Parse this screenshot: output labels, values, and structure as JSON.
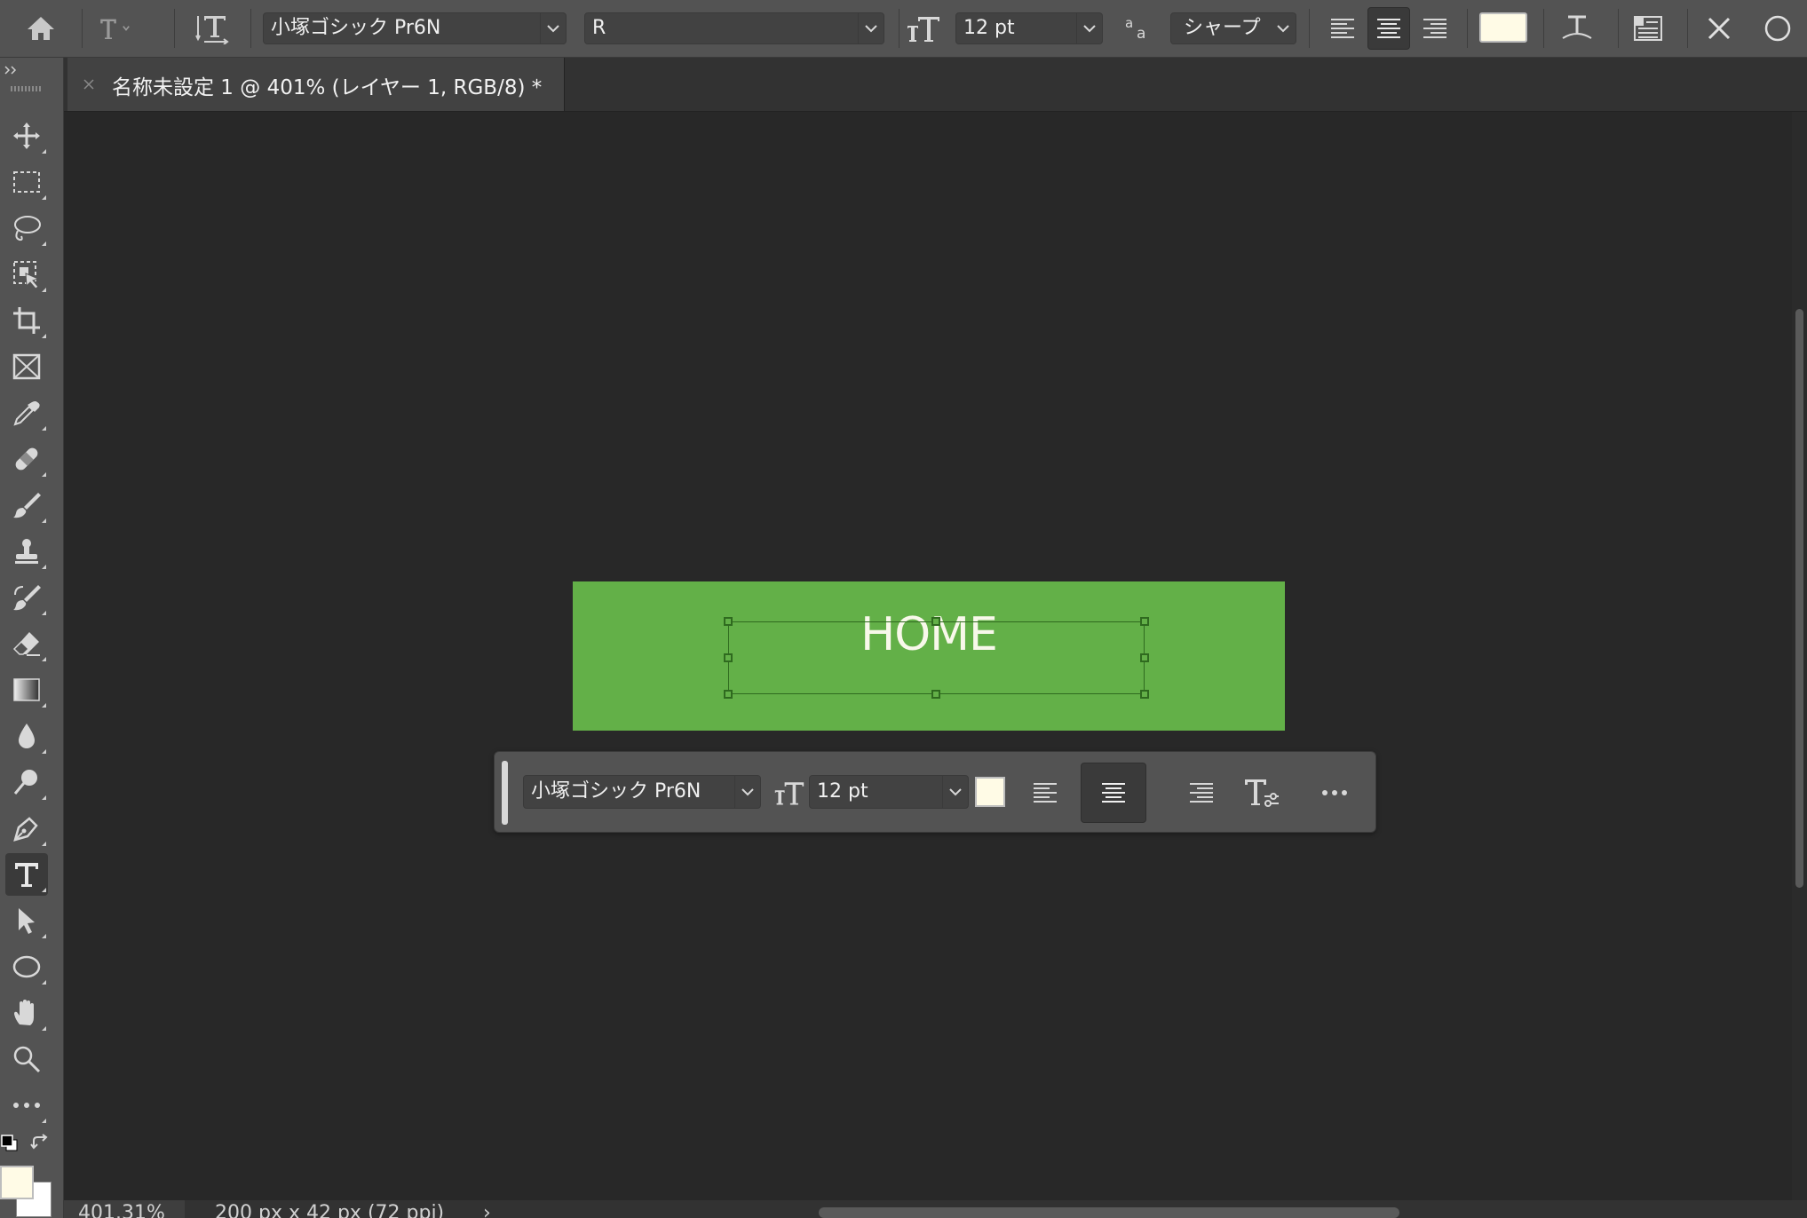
{
  "options_bar": {
    "font_family": "小塚ゴシック Pr6N",
    "font_style": "R",
    "font_size": "12 pt",
    "antialias": "シャープ",
    "text_color": "#fffbe6"
  },
  "document_tab": {
    "title": "名称未設定 1 @ 401% (レイヤー 1, RGB/8) *"
  },
  "canvas": {
    "background_color": "#63b048",
    "text": "HOME",
    "text_color": "#f8f8ea"
  },
  "context_bar": {
    "font_family": "小塚ゴシック Pr6N",
    "font_size": "12 pt",
    "text_color": "#fffbe6",
    "alignment_selected": "center"
  },
  "status_bar": {
    "zoom": "401.31%",
    "doc_info": "200 px x 42 px (72 ppi)"
  },
  "toolbar": {
    "active_tool": "type-tool",
    "foreground_color": "#000000",
    "background_color": "#ffffff",
    "swatch_front": "#fffbe6"
  }
}
